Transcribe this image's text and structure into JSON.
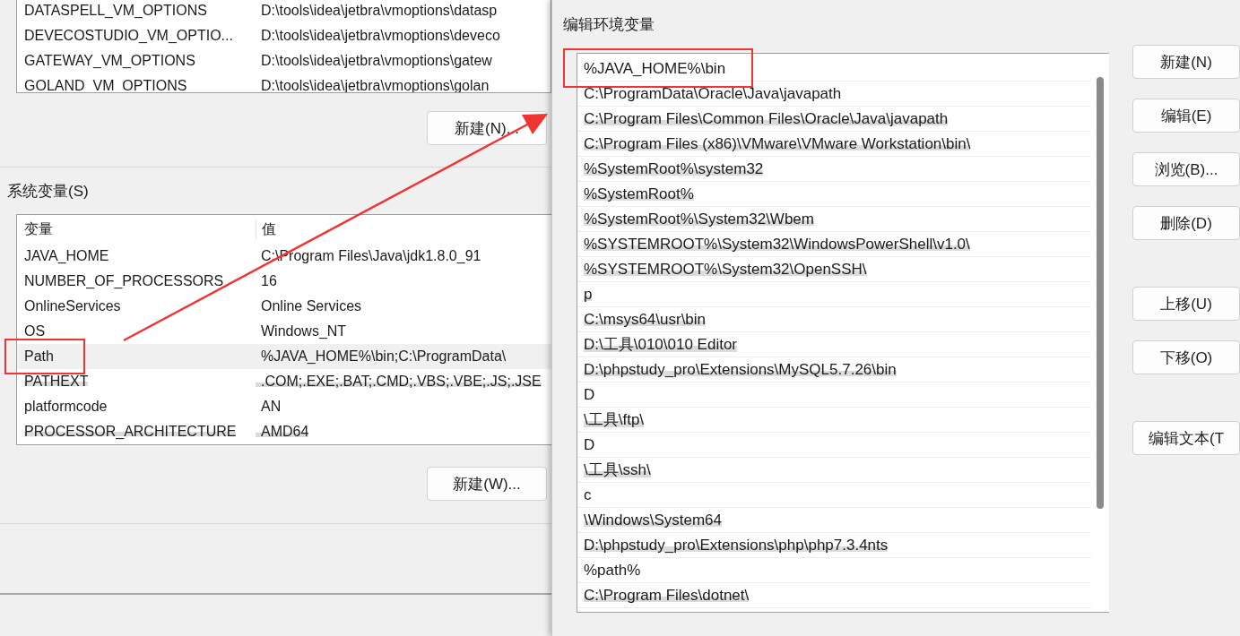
{
  "user_variables": {
    "rows": [
      {
        "name": "DATASPELL_VM_OPTIONS",
        "value": "D:\\tools\\idea\\jetbra\\vmoptions\\datasp"
      },
      {
        "name": "DEVECOSTUDIO_VM_OPTIO...",
        "value": "D:\\tools\\idea\\jetbra\\vmoptions\\deveco"
      },
      {
        "name": "GATEWAY_VM_OPTIONS",
        "value": "D:\\tools\\idea\\jetbra\\vmoptions\\gatew"
      },
      {
        "name": "GOLAND_VM_OPTIONS",
        "value": "D:\\tools\\idea\\jetbra\\vmoptions\\golan"
      }
    ],
    "new_button": "新建(N)..."
  },
  "system_variables": {
    "label": "系统变量(S)",
    "columns": [
      "变量",
      "值"
    ],
    "rows": [
      {
        "name": "JAVA_HOME",
        "value": "C:\\Program Files\\Java\\jdk1.8.0_91",
        "selected": false,
        "annotated": false,
        "blurred": false
      },
      {
        "name": "NUMBER_OF_PROCESSORS",
        "value": "16",
        "selected": false,
        "annotated": false,
        "blurred": false
      },
      {
        "name": "OnlineServices",
        "value": "Online Services",
        "selected": false,
        "annotated": false,
        "blurred": false
      },
      {
        "name": "OS",
        "value": "Windows_NT",
        "selected": false,
        "annotated": false,
        "blurred": false
      },
      {
        "name": "Path",
        "value": "%JAVA_HOME%\\bin;C:\\ProgramData\\",
        "selected": true,
        "annotated": true,
        "blurred": false
      },
      {
        "name": "PATHEXT",
        "value": ".COM;.EXE;.BAT;.CMD;.VBS;.VBE;.JS;.JSE",
        "selected": false,
        "annotated": false,
        "blurred": true
      },
      {
        "name": "platformcode",
        "value": "AN",
        "selected": false,
        "annotated": false,
        "blurred": false
      },
      {
        "name": "PROCESSOR_ARCHITECTURE",
        "value": "AMD64",
        "selected": false,
        "annotated": false,
        "blurred": true
      }
    ],
    "new_button": "新建(W)..."
  },
  "annotation_arrow": true,
  "dialog": {
    "title": "编辑环境变量",
    "entries": [
      {
        "text": "%JAVA_HOME%\\bin",
        "annotated": true,
        "blurred": false
      },
      {
        "text": "C:\\ProgramData\\Oracle\\Java\\javapath",
        "annotated": false,
        "blurred": false
      },
      {
        "text": "C:\\Program Files\\Common Files\\Oracle\\Java\\javapath",
        "annotated": false,
        "blurred": true
      },
      {
        "text": "C:\\Program Files (x86)\\VMware\\VMware Workstation\\bin\\",
        "annotated": false,
        "blurred": true
      },
      {
        "text": "%SystemRoot%\\system32",
        "annotated": false,
        "blurred": true
      },
      {
        "text": "%SystemRoot%",
        "annotated": false,
        "blurred": true
      },
      {
        "text": "%SystemRoot%\\System32\\Wbem",
        "annotated": false,
        "blurred": true
      },
      {
        "text": "%SYSTEMROOT%\\System32\\WindowsPowerShell\\v1.0\\",
        "annotated": false,
        "blurred": true
      },
      {
        "text": "%SYSTEMROOT%\\System32\\OpenSSH\\",
        "annotated": false,
        "blurred": true
      },
      {
        "text": "p",
        "annotated": false,
        "blurred": true
      },
      {
        "text": "C:\\msys64\\usr\\bin",
        "annotated": false,
        "blurred": true
      },
      {
        "text": "D:\\工具\\010\\010 Editor",
        "annotated": false,
        "blurred": true
      },
      {
        "text": "D:\\phpstudy_pro\\Extensions\\MySQL5.7.26\\bin",
        "annotated": false,
        "blurred": true
      },
      {
        "text": "D",
        "annotated": false,
        "blurred": false
      },
      {
        "text": "\\工具\\ftp\\",
        "annotated": false,
        "blurred": true
      },
      {
        "text": "D",
        "annotated": false,
        "blurred": false
      },
      {
        "text": "\\工具\\ssh\\",
        "annotated": false,
        "blurred": true
      },
      {
        "text": "c",
        "annotated": false,
        "blurred": false
      },
      {
        "text": "\\Windows\\System64",
        "annotated": false,
        "blurred": true
      },
      {
        "text": "D:\\phpstudy_pro\\Extensions\\php\\php7.3.4nts",
        "annotated": false,
        "blurred": true
      },
      {
        "text": "%path%",
        "annotated": false,
        "blurred": false
      },
      {
        "text": "C:\\Program Files\\dotnet\\",
        "annotated": false,
        "blurred": true
      }
    ],
    "button_groups": [
      [
        "新建(N)",
        "编辑(E)",
        "浏览(B)...",
        "删除(D)"
      ],
      [
        "上移(U)",
        "下移(O)"
      ],
      [
        "编辑文本(T"
      ]
    ]
  }
}
